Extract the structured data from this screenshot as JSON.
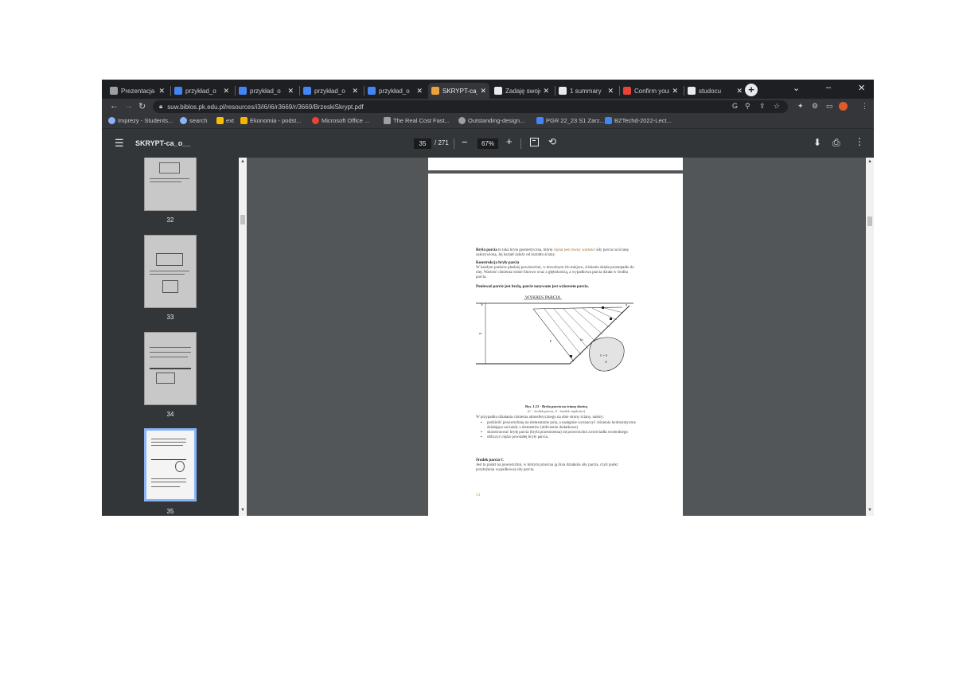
{
  "tabs": [
    {
      "label": "Prezentacja |",
      "active": false,
      "color": "#9aa0a6"
    },
    {
      "label": "przykład_o",
      "active": false,
      "color": "#4285f4"
    },
    {
      "label": "przykład_o",
      "active": false,
      "color": "#4285f4"
    },
    {
      "label": "przykład_o",
      "active": false,
      "color": "#4285f4"
    },
    {
      "label": "przykład_o",
      "active": false,
      "color": "#4285f4"
    },
    {
      "label": "SKRYPT-ca_c",
      "active": true,
      "color": "#e8a33c"
    },
    {
      "label": "Zadaję swoje",
      "active": false,
      "color": "#e8eaed"
    },
    {
      "label": "1 summary",
      "active": false,
      "color": "#e8eaed"
    },
    {
      "label": "Confirm your",
      "active": false,
      "color": "#ea4335"
    },
    {
      "label": "studocu",
      "active": false,
      "color": "#e8eaed"
    }
  ],
  "url": "suw.biblos.pk.edu.pl/resources/i3/i6/i6/r3669/r/3669/BrzeskiSkrypt.pdf",
  "bookmarks": [
    {
      "label": "Imprezy - Students...",
      "color": "#8ab4f8"
    },
    {
      "label": "search",
      "color": "#8ab4f8"
    },
    {
      "label": "ext",
      "color": "#fbbc04"
    },
    {
      "label": "Ekonomia - podst...",
      "color": "#f4b400"
    },
    {
      "label": "Microsoft Office ...",
      "color": "#ea4335"
    },
    {
      "label": "The Real Cost Fast...",
      "color": "#9aa0a6"
    },
    {
      "label": "Outstanding-design...",
      "color": "#9aa0a6"
    },
    {
      "label": "PGR 22_23 S1 Zarz...",
      "color": "#4285f4"
    },
    {
      "label": "BZTechd-2022-Lect...",
      "color": "#4285f4"
    }
  ],
  "pdf": {
    "title": "SKRYPT-ca_o__",
    "current_page": "35",
    "total_pages": "/ 271",
    "zoom": "67%"
  },
  "thumbnails": [
    {
      "num": "32",
      "selected": false
    },
    {
      "num": "33",
      "selected": false
    },
    {
      "num": "34",
      "selected": false
    },
    {
      "num": "35",
      "selected": true
    }
  ],
  "page_text": {
    "para1_a": "Bryła parcia",
    "para1_b": " to taka bryła geometryczna, której ",
    "para1_c": "ciężar jest równy wartości",
    "para1_d": " siły parcia na ścianę zakrzywioną. Jej kształt zależy od kształtu ściany.",
    "heading1": "Konstrukcja bryły parcia",
    "para2": "W każdym punkcie płaskiej powierzchni, w dowolnym ich miejscu, ciśnienie działa prostopadle do niej. Wartość ciśnienia rośnie liniowo wraz z głębokością, a wypadkowa parcia działa w środku parcia.",
    "para3": "Ponieważ parcie jest bryłą, parcie nazywane jest wykresem parcia.",
    "figure_label": "WYKRES PARCIA",
    "figure_caption_1": "Rys. 1.12 - Bryła parcia na ścianę skośną",
    "figure_caption_2": "(C - środek parcia, S - środek ciężkości)",
    "para4": "W przypadku działania ciśnienia atmosferycznego na obie strony ściany, należy:",
    "bullet1": "podzielić powierzchnię na elementarne pola, a następnie wyznaczyć ciśnienie hydrostatyczne działające na każdy z elementów (obliczenie dodatkowe)",
    "bullet2": "skonstruować bryłę parcia (bryła przestrzenna) od powierzchni zwierciadła swobodnego",
    "bullet3": "obliczyć ciężar powstałej bryły parcia.",
    "heading2": "Środek parcia C",
    "para5": "Jest to punkt na powierzchni, w którym przecina ją linia działania siły parcia, czyli punkt przyłożenia wypadkowej siły parcia.",
    "page_number": "34"
  }
}
